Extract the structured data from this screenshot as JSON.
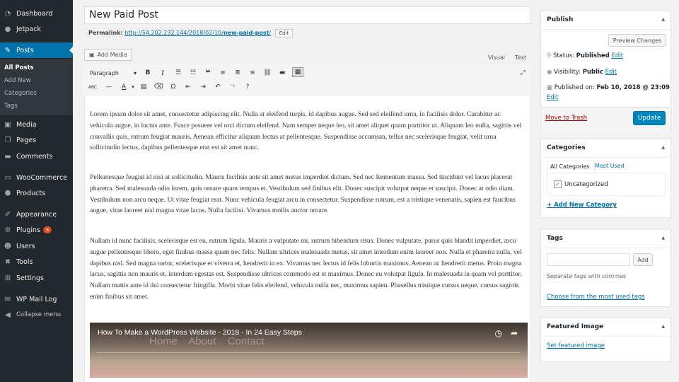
{
  "sidebar": {
    "items": [
      {
        "label": "Dashboard",
        "icon": "dashboard-icon",
        "glyph": "◔"
      },
      {
        "label": "Jetpack",
        "icon": "jetpack-icon",
        "glyph": "●"
      },
      {
        "label": "Posts",
        "icon": "pin-icon",
        "glyph": "✎"
      },
      {
        "label": "Media",
        "icon": "media-icon",
        "glyph": "▣"
      },
      {
        "label": "Pages",
        "icon": "pages-icon",
        "glyph": "❐"
      },
      {
        "label": "Comments",
        "icon": "comment-icon",
        "glyph": "▬"
      },
      {
        "label": "WooCommerce",
        "icon": "woocommerce-icon",
        "glyph": "▭"
      },
      {
        "label": "Products",
        "icon": "products-icon",
        "glyph": "⬢"
      },
      {
        "label": "Appearance",
        "icon": "appearance-icon",
        "glyph": "✐"
      },
      {
        "label": "Plugins",
        "icon": "plugins-icon",
        "glyph": "⚙",
        "badge": "6"
      },
      {
        "label": "Users",
        "icon": "users-icon",
        "glyph": "☻"
      },
      {
        "label": "Tools",
        "icon": "tools-icon",
        "glyph": "✖"
      },
      {
        "label": "Settings",
        "icon": "settings-icon",
        "glyph": "⊞"
      },
      {
        "label": "WP Mail Log",
        "icon": "mail-icon",
        "glyph": "✉"
      },
      {
        "label": "Collapse menu",
        "icon": "collapse-icon",
        "glyph": "◀"
      }
    ],
    "submenu": [
      "All Posts",
      "Add New",
      "Categories",
      "Tags"
    ]
  },
  "editor": {
    "title": "New Paid Post",
    "permalink_label": "Permalink:",
    "permalink_base": "http://54.202.232.144/2018/02/10/",
    "permalink_slug": "new-paid-post",
    "permalink_end": "/",
    "edit_label": "Edit",
    "add_media": "Add Media",
    "tab_visual": "Visual",
    "tab_text": "Text",
    "format": "Paragraph",
    "paragraphs": [
      "Lorem ipsum dolor sit amet, consectetur adipiscing elit. Nulla at eleifend turpis, id dapibus augue. Sed sed eleifend urna, in facilisis dolor. Curabitur ac vehicula augue, in luctus ante. Fusce posuere vel orci dictum eleifend. Nam semper neque leo, sit amet aliquet quam porttitor ut. Aliquam leo nulla, sagittis vel convallis quis, rutrum feugiat mauris. Aenean efficitur aliquam lectus at pellentesque. Suspendisse accumsan, tellus nec scelerisque feugiat, velit urna sollicitudin lectus, dapibus pellentesque erat est sit amet nunc.",
      "Pellentesque feugiat id nisi at sollicitudin. Mauris facilisis ante sit amet metus imperdiet dictum. Sed nec fermentum massa. Sed tincidunt vel lacus placerat pharetra. Sed malesuada odio lorem, quis ornare quam tempus et. Vestibulum sed finibus elit. Donec suscipit volutpat neque et suscipit. Donec at odio diam. Vestibulum non arcu neque. Ut vitae feugiat erat. Nunc vehicula feugiat arcu in consectetur. Suspendisse rutrum, est a tristique venenatis, sapien est faucibus augue, vitae laoreet nisl magna vitae lacus. Nulla facilisi. Vivamus mollis auctor ornare.",
      "Nullam id nunc facilisis, scelerisque est eu, rutrum ligula. Mauris a vulputate mi, rutrum bibendum risus. Donec vulputate, purus quis blandit imperdiet, arcu augue pellentesque libero, eget finibus massa quam nec felis. Nullam ultrices malesuada metus, sit amet interdum enim laoreet non. Nulla et pharetra nulla, vel dapibus nisl. Sed magna tortor, scelerisque et viverra et, hendrerit in ex. Vivamus nec lectus id felis lobortis maximus. Aenean ac hendrerit metus. Proin magna lacus, sagittis non mauris et, interdum egestas est. Suspendisse ultrices commodo est et maximus. Donec eu volutpat ligula. In malesuada in quam vel porttitor. Nullam mattis ante id dui consectetur fringilla. Morbi vitae felis eleifend, vehicula nulla nec, maximus sapien. Phasellus tristique cursus neque, cursus sagittis enim finibus sit amet."
    ],
    "video_title": "How To Make a WordPress Website - 2018 - In 24 Easy Steps",
    "video_ghost": "Home About Contact"
  },
  "publish": {
    "heading": "Publish",
    "preview": "Preview Changes",
    "status_label": "Status:",
    "status_value": "Published",
    "visibility_label": "Visibility:",
    "visibility_value": "Public",
    "published_label": "Published on:",
    "published_value": "Feb 10, 2018 @ 23:09",
    "edit": "Edit",
    "trash": "Move to Trash",
    "update": "Update"
  },
  "categories": {
    "heading": "Categories",
    "tab_all": "All Categories",
    "tab_used": "Most Used",
    "item": "Uncategorized",
    "item_checked": true,
    "add_new": "+ Add New Category"
  },
  "tags": {
    "heading": "Tags",
    "add": "Add",
    "hint": "Separate tags with commas",
    "choose": "Choose from the most used tags"
  },
  "featured": {
    "heading": "Featured Image",
    "set": "Set featured image"
  },
  "colors": {
    "accent": "#0073aa",
    "sidebar": "#23282d",
    "button": "#0085ba",
    "trash": "#a00"
  }
}
